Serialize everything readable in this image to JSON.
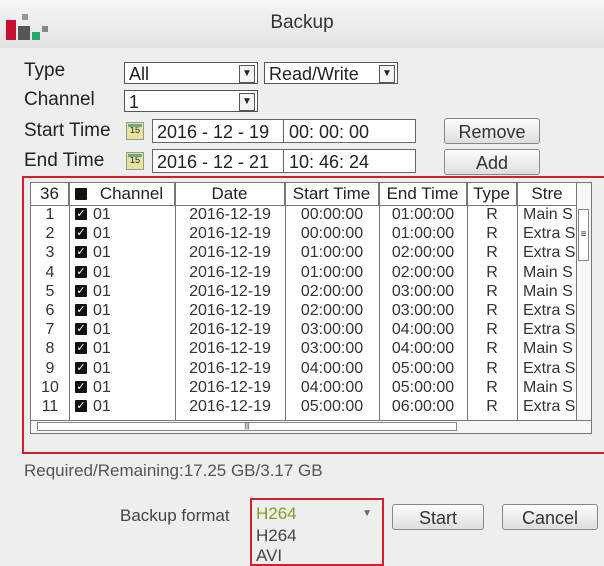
{
  "window": {
    "title": "Backup"
  },
  "filters": {
    "type_label": "Type",
    "type_value": "All",
    "mode_value": "Read/Write",
    "channel_label": "Channel",
    "channel_value": "1",
    "start_time_label": "Start Time",
    "start_date": "2016 - 12 - 19",
    "start_time": "00: 00: 00",
    "end_time_label": "End Time",
    "end_date": "2016 - 12 - 21",
    "end_time": "10: 46: 24",
    "calendar_day": "15",
    "remove_label": "Remove",
    "add_label": "Add"
  },
  "table": {
    "columns": [
      "36",
      "Channel",
      "Date",
      "Start Time",
      "End Time",
      "Type",
      "Stre"
    ],
    "rows": [
      [
        "1",
        "01",
        "2016-12-19",
        "00:00:00",
        "01:00:00",
        "R",
        "Main S"
      ],
      [
        "2",
        "01",
        "2016-12-19",
        "00:00:00",
        "01:00:00",
        "R",
        "Extra S"
      ],
      [
        "3",
        "01",
        "2016-12-19",
        "01:00:00",
        "02:00:00",
        "R",
        "Extra S"
      ],
      [
        "4",
        "01",
        "2016-12-19",
        "01:00:00",
        "02:00:00",
        "R",
        "Main S"
      ],
      [
        "5",
        "01",
        "2016-12-19",
        "02:00:00",
        "03:00:00",
        "R",
        "Main S"
      ],
      [
        "6",
        "01",
        "2016-12-19",
        "02:00:00",
        "03:00:00",
        "R",
        "Extra S"
      ],
      [
        "7",
        "01",
        "2016-12-19",
        "03:00:00",
        "04:00:00",
        "R",
        "Extra S"
      ],
      [
        "8",
        "01",
        "2016-12-19",
        "03:00:00",
        "04:00:00",
        "R",
        "Main S"
      ],
      [
        "9",
        "01",
        "2016-12-19",
        "04:00:00",
        "05:00:00",
        "R",
        "Extra S"
      ],
      [
        "10",
        "01",
        "2016-12-19",
        "04:00:00",
        "05:00:00",
        "R",
        "Main S"
      ],
      [
        "11",
        "01",
        "2016-12-19",
        "05:00:00",
        "06:00:00",
        "R",
        "Extra S"
      ]
    ]
  },
  "status": {
    "text": "Required/Remaining:17.25 GB/3.17 GB"
  },
  "backup": {
    "format_label": "Backup format",
    "format_value": "H264",
    "options": [
      "H264",
      "AVI"
    ],
    "start_label": "Start",
    "cancel_label": "Cancel"
  },
  "colors": {
    "highlight_border": "#d0202a",
    "selected_format": "#8a9a28"
  }
}
